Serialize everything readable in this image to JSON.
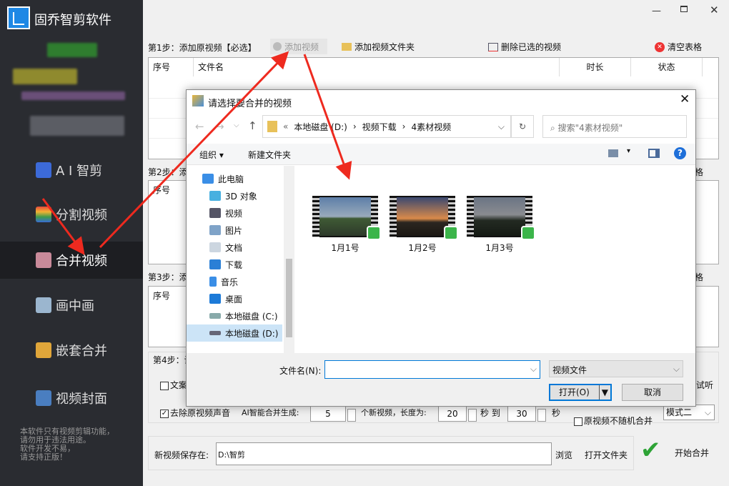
{
  "app": {
    "title": "固乔智剪软件"
  },
  "sidebar": {
    "items": [
      {
        "label": "A I 智剪",
        "icon": "ai-wand-icon"
      },
      {
        "label": "分割视频",
        "icon": "split-icon"
      },
      {
        "label": "合并视频",
        "icon": "merge-icon",
        "selected": true
      },
      {
        "label": "画中画",
        "icon": "pip-icon"
      },
      {
        "label": "嵌套合并",
        "icon": "nest-icon"
      },
      {
        "label": "视频封面",
        "icon": "cover-icon"
      }
    ],
    "notice": [
      "本软件只有视频剪辑功能，",
      "请勿用于违法用途。",
      "软件开发不易，",
      "请支持正版！"
    ]
  },
  "step1": {
    "label": "第1步：添加原视频【必选】",
    "add_video": "添加视频",
    "add_folder": "添加视频文件夹",
    "delete_selected": "删除已选的视频",
    "clear_table": "清空表格",
    "columns": [
      "序号",
      "文件名",
      "时长",
      "状态"
    ]
  },
  "step2": {
    "label": "第2步：添",
    "col": "序号",
    "right": "格"
  },
  "step3": {
    "label": "第3步：添",
    "col": "序号",
    "right": "格"
  },
  "step4": {
    "label": "第4步：设",
    "copy_checkbox": "文案",
    "listen": "试听",
    "remove_audio": "去除原视频声音",
    "ai_generate": "AI智能合并生成:",
    "count": "5",
    "per_video": "个新视频，长度为:",
    "min_len": "20",
    "sec_to": "秒 到",
    "max_len": "30",
    "sec": "秒",
    "no_random": "原视频不随机合并",
    "mode": "模式二"
  },
  "save": {
    "label": "新视频保存在:",
    "path": "D:\\智剪",
    "browse": "浏览",
    "open_folder": "打开文件夹",
    "start": "开始合并"
  },
  "dialog": {
    "title": "请选择要合并的视频",
    "breadcrumb": [
      "本地磁盘 (D:)",
      "视频下载",
      "4素材视频"
    ],
    "search_placeholder": "搜索\"4素材视频\"",
    "organize": "组织",
    "new_folder": "新建文件夹",
    "nav": [
      "此电脑",
      "3D 对象",
      "视频",
      "图片",
      "文档",
      "下载",
      "音乐",
      "桌面",
      "本地磁盘 (C:)",
      "本地磁盘 (D:)"
    ],
    "files": [
      "1月1号",
      "1月2号",
      "1月3号"
    ],
    "filename_label": "文件名(N):",
    "filename_value": "",
    "filetype": "视频文件",
    "open": "打开(O)",
    "cancel": "取消"
  },
  "colors": {
    "sidebar": "#2a2c31",
    "annotation": "#ee2a1f",
    "accent": "#0078d7"
  }
}
